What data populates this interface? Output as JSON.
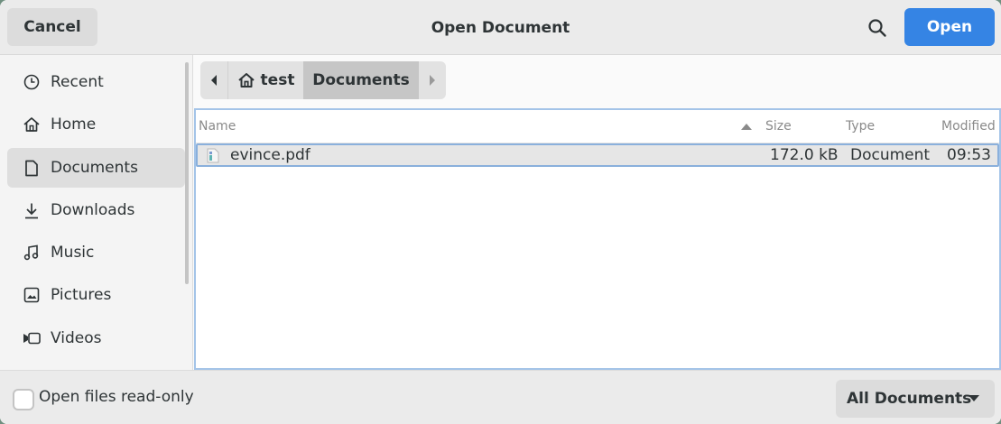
{
  "header": {
    "cancel_label": "Cancel",
    "title": "Open Document",
    "search_icon": "search-icon",
    "open_label": "Open",
    "accent": "#3584e4"
  },
  "sidebar": {
    "items": [
      {
        "label": "Recent",
        "icon": "clock-icon",
        "active": false
      },
      {
        "label": "Home",
        "icon": "home-icon",
        "active": false
      },
      {
        "label": "Documents",
        "icon": "document-icon",
        "active": true
      },
      {
        "label": "Downloads",
        "icon": "download-icon",
        "active": false
      },
      {
        "label": "Music",
        "icon": "music-icon",
        "active": false
      },
      {
        "label": "Pictures",
        "icon": "picture-icon",
        "active": false
      },
      {
        "label": "Videos",
        "icon": "video-icon",
        "active": false
      }
    ]
  },
  "pathbar": {
    "home_label": "test",
    "current_label": "Documents"
  },
  "filelist": {
    "columns": {
      "name": "Name",
      "size": "Size",
      "type": "Type",
      "modified": "Modified"
    },
    "sort_column": "Size",
    "rows": [
      {
        "name": "evince.pdf",
        "size": "172.0 kB",
        "type": "Document",
        "modified": "09:53",
        "selected": true
      }
    ]
  },
  "footer": {
    "readonly_label": "Open files read-only",
    "readonly_checked": false,
    "filter_label": "All Documents"
  }
}
